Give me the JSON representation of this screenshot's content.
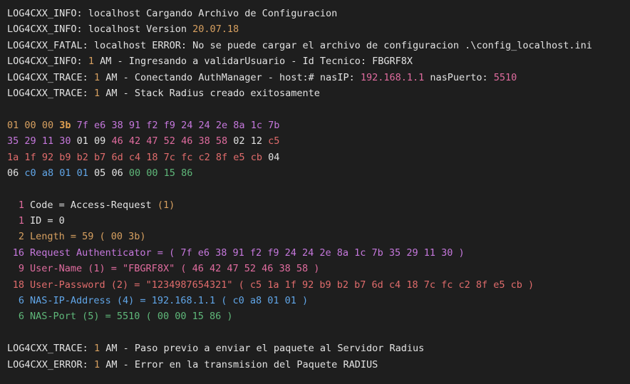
{
  "colors": {
    "background": "#1e1e1e",
    "text": "#e2e2e2",
    "orange": "#d7a060",
    "purple": "#c678dd",
    "pink": "#e06c9f",
    "red": "#e06c6c",
    "blue": "#61a6e8",
    "green": "#5fb87a"
  },
  "log": {
    "l1": {
      "tag": "LOG4CXX_INFO:",
      "msg": " localhost Cargando Archivo de Configuracion"
    },
    "l2": {
      "tag": "LOG4CXX_INFO:",
      "msg": " localhost Version ",
      "version": "20.07.18"
    },
    "l3": {
      "tag": "LOG4CXX_FATAL:",
      "msg": " localhost ERROR: No se puede cargar el archivo de configuracion .\\config_localhost.ini"
    },
    "l4": {
      "tag": "LOG4CXX_INFO:",
      "num": "1",
      "msg": " AM - Ingresando a validarUsuario - Id Tecnico: FBGRF8X"
    },
    "l5": {
      "tag": "LOG4CXX_TRACE:",
      "num": "1",
      "msg": " AM - Conectando AuthManager - host:# nasIP: ",
      "ip": "192.168.1.1",
      "msg2": " nasPuerto: ",
      "port": "5510"
    },
    "l6": {
      "tag": "LOG4CXX_TRACE:",
      "num": "1",
      "msg": " AM - Stack Radius creado exitosamente"
    },
    "l7": {
      "tag": "LOG4CXX_TRACE:",
      "num": "1",
      "msg": " AM - Paso previo a enviar el paquete al Servidor Radius"
    },
    "l8": {
      "tag": "LOG4CXX_ERROR:",
      "num": "1",
      "msg": " AM - Error en la transmision del Paquete RADIUS"
    }
  },
  "hex": {
    "row1": [
      {
        "t": "01",
        "c": "o"
      },
      {
        "t": "00",
        "c": "o"
      },
      {
        "t": "00",
        "c": "o"
      },
      {
        "t": "3b",
        "c": "ob"
      },
      {
        "t": "7f",
        "c": "p"
      },
      {
        "t": "e6",
        "c": "p"
      },
      {
        "t": "38",
        "c": "p"
      },
      {
        "t": "91",
        "c": "p"
      },
      {
        "t": "f2",
        "c": "p"
      },
      {
        "t": "f9",
        "c": "p"
      },
      {
        "t": "24",
        "c": "p"
      },
      {
        "t": "24",
        "c": "p"
      },
      {
        "t": "2e",
        "c": "p"
      },
      {
        "t": "8a",
        "c": "p"
      },
      {
        "t": "1c",
        "c": "p"
      },
      {
        "t": "7b",
        "c": "p"
      }
    ],
    "row2": [
      {
        "t": "35",
        "c": "p"
      },
      {
        "t": "29",
        "c": "p"
      },
      {
        "t": "11",
        "c": "p"
      },
      {
        "t": "30",
        "c": "p"
      },
      {
        "t": "01",
        "c": "w"
      },
      {
        "t": "09",
        "c": "w"
      },
      {
        "t": "46",
        "c": "pk"
      },
      {
        "t": "42",
        "c": "pk"
      },
      {
        "t": "47",
        "c": "pk"
      },
      {
        "t": "52",
        "c": "pk"
      },
      {
        "t": "46",
        "c": "pk"
      },
      {
        "t": "38",
        "c": "pk"
      },
      {
        "t": "58",
        "c": "pk"
      },
      {
        "t": "02",
        "c": "w"
      },
      {
        "t": "12",
        "c": "w"
      },
      {
        "t": "c5",
        "c": "r"
      }
    ],
    "row3": [
      {
        "t": "1a",
        "c": "r"
      },
      {
        "t": "1f",
        "c": "r"
      },
      {
        "t": "92",
        "c": "r"
      },
      {
        "t": "b9",
        "c": "r"
      },
      {
        "t": "b2",
        "c": "r"
      },
      {
        "t": "b7",
        "c": "r"
      },
      {
        "t": "6d",
        "c": "r"
      },
      {
        "t": "c4",
        "c": "r"
      },
      {
        "t": "18",
        "c": "r"
      },
      {
        "t": "7c",
        "c": "r"
      },
      {
        "t": "fc",
        "c": "r"
      },
      {
        "t": "c2",
        "c": "r"
      },
      {
        "t": "8f",
        "c": "r"
      },
      {
        "t": "e5",
        "c": "r"
      },
      {
        "t": "cb",
        "c": "r"
      },
      {
        "t": "04",
        "c": "w"
      }
    ],
    "row4": [
      {
        "t": "06",
        "c": "w"
      },
      {
        "t": "c0",
        "c": "b"
      },
      {
        "t": "a8",
        "c": "b"
      },
      {
        "t": "01",
        "c": "b"
      },
      {
        "t": "01",
        "c": "b"
      },
      {
        "t": "05",
        "c": "w"
      },
      {
        "t": "06",
        "c": "w"
      },
      {
        "t": "00",
        "c": "g"
      },
      {
        "t": "00",
        "c": "g"
      },
      {
        "t": "15",
        "c": "g"
      },
      {
        "t": "86",
        "c": "g"
      }
    ]
  },
  "fields": [
    {
      "n": "1",
      "c": "w",
      "label": "Code = Access-Request",
      "paren": " (1)",
      "value": "",
      "bytes": ""
    },
    {
      "n": "1",
      "c": "w",
      "label": "ID = 0",
      "paren": "",
      "value": "",
      "bytes": ""
    },
    {
      "n": "2",
      "c": "o",
      "label": "Length = 59",
      "paren": "",
      "value": "",
      "bytes": " ( 00 3b)"
    },
    {
      "n": "16",
      "c": "p",
      "label": "Request Authenticator = ",
      "paren": "",
      "value": "",
      "bytes": "( 7f e6 38 91 f2 f9 24 24 2e 8a 1c 7b 35 29 11 30 )"
    },
    {
      "n": "9",
      "c": "pk",
      "label": "User-Name (1) = ",
      "paren": "",
      "value": "\"FBGRF8X\"",
      "bytes": " ( 46 42 47 52 46 38 58 )"
    },
    {
      "n": "18",
      "c": "r",
      "label": "User-Password (2) = ",
      "paren": "",
      "value": "\"1234987654321\"",
      "bytes": " ( c5 1a 1f 92 b9 b2 b7 6d c4 18 7c fc c2 8f e5 cb )"
    },
    {
      "n": "6",
      "c": "b",
      "label": "NAS-IP-Address (4) = ",
      "paren": "",
      "value": "192.168.1.1",
      "bytes": " ( c0 a8 01 01 )"
    },
    {
      "n": "6",
      "c": "g",
      "label": "NAS-Port (5) = ",
      "paren": "",
      "value": "5510",
      "bytes": " ( 00 00 15 86 )"
    }
  ]
}
